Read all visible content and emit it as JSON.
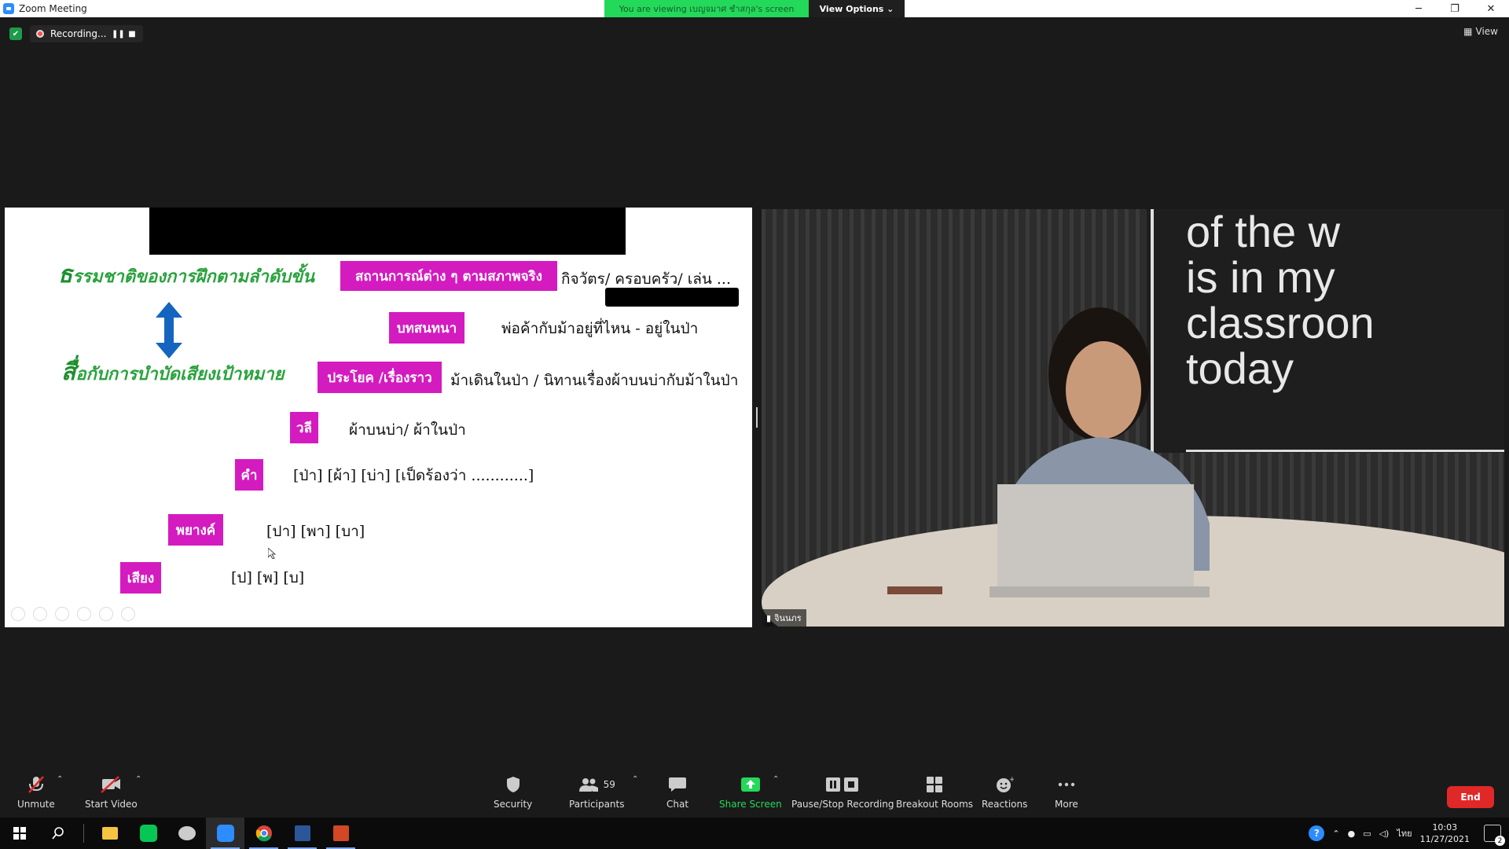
{
  "window": {
    "title": "Zoom Meeting"
  },
  "banner": {
    "viewing": "You are viewing เบญจมาศ ชำสกุล's screen",
    "view_options": "View Options ⌄"
  },
  "window_controls": {
    "minimize": "─",
    "restore": "❐",
    "close": "✕"
  },
  "recording": {
    "label": "Recording...",
    "pause": "❚❚",
    "stop": "■"
  },
  "view_button": "View",
  "slide": {
    "title_line1_cap": "ธ",
    "title_line1": "รรมชาติของการฝึกตามลำดับขั้น",
    "title_line2_cap": "สื่",
    "title_line2": "อกับการบำบัดเสียงเป้าหมาย",
    "tags": [
      "สถานการณ์ต่าง ๆ ตามสภาพจริง",
      "บทสนทนา",
      "ประโยค /เรื่องราว",
      "วลี",
      "คำ",
      "พยางค์",
      "เสียง"
    ],
    "lines": [
      "กิจวัตร/ ครอบครัว/ เล่น ...",
      "พ่อค้ากับม้าอยู่ที่ไหน  - อยู่ในป่า",
      "ม้าเดินในป่า / นิทานเรื่องผ้าบนบ่ากับม้าในป่า",
      "ผ้าบนบ่า/  ผ้าในป่า",
      "[ป่า]  [ผ้า]  [บ่า]  [เป็ดร้องว่า ............]",
      "[ปา]  [พา]  [บา]",
      "[ป]  [พ]  [บ]"
    ]
  },
  "video": {
    "participant_name": "จินนภร",
    "wall_text": [
      "of the w",
      "is in my",
      "classroon",
      "today"
    ]
  },
  "toolbar": {
    "unmute": "Unmute",
    "start_video": "Start Video",
    "security": "Security",
    "participants": "Participants",
    "participants_count": "59",
    "chat": "Chat",
    "share_screen": "Share Screen",
    "pause_stop_recording": "Pause/Stop Recording",
    "breakout_rooms": "Breakout Rooms",
    "reactions": "Reactions",
    "more": "More",
    "end": "End"
  },
  "taskbar": {
    "language": "ไทย",
    "time": "10:03",
    "date": "11/27/2021",
    "notifications": "2"
  }
}
